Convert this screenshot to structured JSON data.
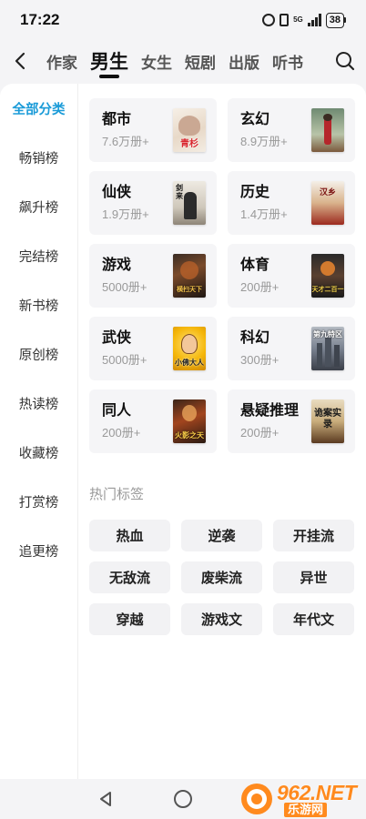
{
  "status_bar": {
    "time": "17:22",
    "network": "5G",
    "battery": "38"
  },
  "nav": {
    "tabs": [
      {
        "label": "作家"
      },
      {
        "label": "男生"
      },
      {
        "label": "女生"
      },
      {
        "label": "短剧"
      },
      {
        "label": "出版"
      },
      {
        "label": "听书"
      }
    ],
    "active_tab": "男生"
  },
  "sidebar": {
    "items": [
      {
        "label": "全部分类"
      },
      {
        "label": "畅销榜"
      },
      {
        "label": "飙升榜"
      },
      {
        "label": "完结榜"
      },
      {
        "label": "新书榜"
      },
      {
        "label": "原创榜"
      },
      {
        "label": "热读榜"
      },
      {
        "label": "收藏榜"
      },
      {
        "label": "打赏榜"
      },
      {
        "label": "追更榜"
      }
    ],
    "active": "全部分类",
    "active_color": "#1a9bd8"
  },
  "categories": [
    {
      "name": "都市",
      "count": "7.6万册+",
      "cover_title": "青杉"
    },
    {
      "name": "玄幻",
      "count": "8.9万册+",
      "cover_title": ""
    },
    {
      "name": "仙侠",
      "count": "1.9万册+",
      "cover_title": "剑来"
    },
    {
      "name": "历史",
      "count": "1.4万册+",
      "cover_title": "汉乡"
    },
    {
      "name": "游戏",
      "count": "5000册+",
      "cover_title": "横扫天下"
    },
    {
      "name": "体育",
      "count": "200册+",
      "cover_title": "天才二百一"
    },
    {
      "name": "武侠",
      "count": "5000册+",
      "cover_title": "小佛大人"
    },
    {
      "name": "科幻",
      "count": "300册+",
      "cover_title": "第九特区"
    },
    {
      "name": "同人",
      "count": "200册+",
      "cover_title": "火影之天"
    },
    {
      "name": "悬疑推理",
      "count": "200册+",
      "cover_title": "诡案实录"
    }
  ],
  "hot_tags": {
    "title": "热门标签",
    "items": [
      {
        "label": "热血"
      },
      {
        "label": "逆袭"
      },
      {
        "label": "开挂流"
      },
      {
        "label": "无敌流"
      },
      {
        "label": "废柴流"
      },
      {
        "label": "异世"
      },
      {
        "label": "穿越"
      },
      {
        "label": "游戏文"
      },
      {
        "label": "年代文"
      }
    ]
  },
  "watermark": {
    "text_top": "962.NET",
    "text_bottom": "乐游网",
    "color": "#ff8a1e"
  }
}
